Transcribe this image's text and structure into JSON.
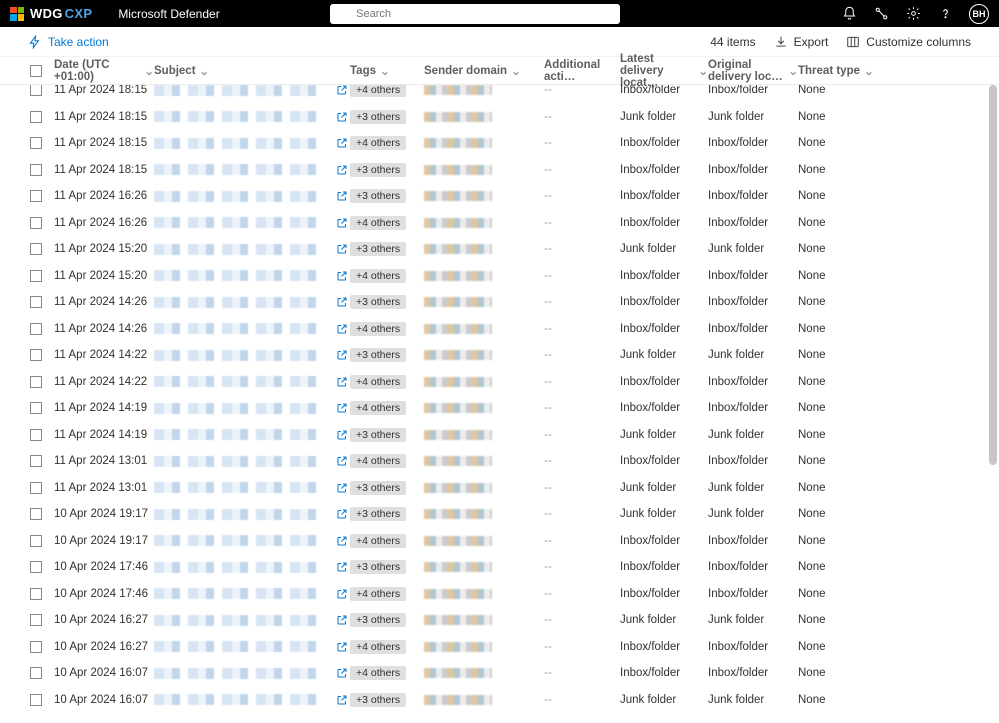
{
  "header": {
    "brand_main": "WDG",
    "brand_sub": "CXP",
    "app_name": "Microsoft Defender",
    "search_placeholder": "Search",
    "avatar_initials": "BH"
  },
  "actionbar": {
    "take_action": "Take action",
    "item_count": "44 items",
    "export": "Export",
    "customize": "Customize columns"
  },
  "columns": {
    "date": "Date (UTC +01:00)",
    "subject": "Subject",
    "tags": "Tags",
    "sender": "Sender domain",
    "additional": "Additional acti…",
    "latest": "Latest delivery locat…",
    "original": "Original delivery loc…",
    "threat": "Threat type"
  },
  "rows": [
    {
      "date": "11 Apr 2024 18:15",
      "tags": "+4 others",
      "addl": "--",
      "latest": "Inbox/folder",
      "orig": "Inbox/folder",
      "threat": "None"
    },
    {
      "date": "11 Apr 2024 18:15",
      "tags": "+3 others",
      "addl": "--",
      "latest": "Junk folder",
      "orig": "Junk folder",
      "threat": "None"
    },
    {
      "date": "11 Apr 2024 18:15",
      "tags": "+4 others",
      "addl": "--",
      "latest": "Inbox/folder",
      "orig": "Inbox/folder",
      "threat": "None"
    },
    {
      "date": "11 Apr 2024 18:15",
      "tags": "+3 others",
      "addl": "--",
      "latest": "Inbox/folder",
      "orig": "Inbox/folder",
      "threat": "None"
    },
    {
      "date": "11 Apr 2024 16:26",
      "tags": "+3 others",
      "addl": "--",
      "latest": "Inbox/folder",
      "orig": "Inbox/folder",
      "threat": "None"
    },
    {
      "date": "11 Apr 2024 16:26",
      "tags": "+4 others",
      "addl": "--",
      "latest": "Inbox/folder",
      "orig": "Inbox/folder",
      "threat": "None"
    },
    {
      "date": "11 Apr 2024 15:20",
      "tags": "+3 others",
      "addl": "--",
      "latest": "Junk folder",
      "orig": "Junk folder",
      "threat": "None"
    },
    {
      "date": "11 Apr 2024 15:20",
      "tags": "+4 others",
      "addl": "--",
      "latest": "Inbox/folder",
      "orig": "Inbox/folder",
      "threat": "None"
    },
    {
      "date": "11 Apr 2024 14:26",
      "tags": "+3 others",
      "addl": "--",
      "latest": "Inbox/folder",
      "orig": "Inbox/folder",
      "threat": "None"
    },
    {
      "date": "11 Apr 2024 14:26",
      "tags": "+4 others",
      "addl": "--",
      "latest": "Inbox/folder",
      "orig": "Inbox/folder",
      "threat": "None"
    },
    {
      "date": "11 Apr 2024 14:22",
      "tags": "+3 others",
      "addl": "--",
      "latest": "Junk folder",
      "orig": "Junk folder",
      "threat": "None"
    },
    {
      "date": "11 Apr 2024 14:22",
      "tags": "+4 others",
      "addl": "--",
      "latest": "Inbox/folder",
      "orig": "Inbox/folder",
      "threat": "None"
    },
    {
      "date": "11 Apr 2024 14:19",
      "tags": "+4 others",
      "addl": "--",
      "latest": "Inbox/folder",
      "orig": "Inbox/folder",
      "threat": "None"
    },
    {
      "date": "11 Apr 2024 14:19",
      "tags": "+3 others",
      "addl": "--",
      "latest": "Junk folder",
      "orig": "Junk folder",
      "threat": "None"
    },
    {
      "date": "11 Apr 2024 13:01",
      "tags": "+4 others",
      "addl": "--",
      "latest": "Inbox/folder",
      "orig": "Inbox/folder",
      "threat": "None"
    },
    {
      "date": "11 Apr 2024 13:01",
      "tags": "+3 others",
      "addl": "--",
      "latest": "Junk folder",
      "orig": "Junk folder",
      "threat": "None"
    },
    {
      "date": "10 Apr 2024 19:17",
      "tags": "+3 others",
      "addl": "--",
      "latest": "Junk folder",
      "orig": "Junk folder",
      "threat": "None"
    },
    {
      "date": "10 Apr 2024 19:17",
      "tags": "+4 others",
      "addl": "--",
      "latest": "Inbox/folder",
      "orig": "Inbox/folder",
      "threat": "None"
    },
    {
      "date": "10 Apr 2024 17:46",
      "tags": "+3 others",
      "addl": "--",
      "latest": "Inbox/folder",
      "orig": "Inbox/folder",
      "threat": "None"
    },
    {
      "date": "10 Apr 2024 17:46",
      "tags": "+4 others",
      "addl": "--",
      "latest": "Inbox/folder",
      "orig": "Inbox/folder",
      "threat": "None"
    },
    {
      "date": "10 Apr 2024 16:27",
      "tags": "+3 others",
      "addl": "--",
      "latest": "Junk folder",
      "orig": "Junk folder",
      "threat": "None"
    },
    {
      "date": "10 Apr 2024 16:27",
      "tags": "+4 others",
      "addl": "--",
      "latest": "Inbox/folder",
      "orig": "Inbox/folder",
      "threat": "None"
    },
    {
      "date": "10 Apr 2024 16:07",
      "tags": "+4 others",
      "addl": "--",
      "latest": "Inbox/folder",
      "orig": "Inbox/folder",
      "threat": "None"
    },
    {
      "date": "10 Apr 2024 16:07",
      "tags": "+3 others",
      "addl": "--",
      "latest": "Junk folder",
      "orig": "Junk folder",
      "threat": "None"
    }
  ]
}
